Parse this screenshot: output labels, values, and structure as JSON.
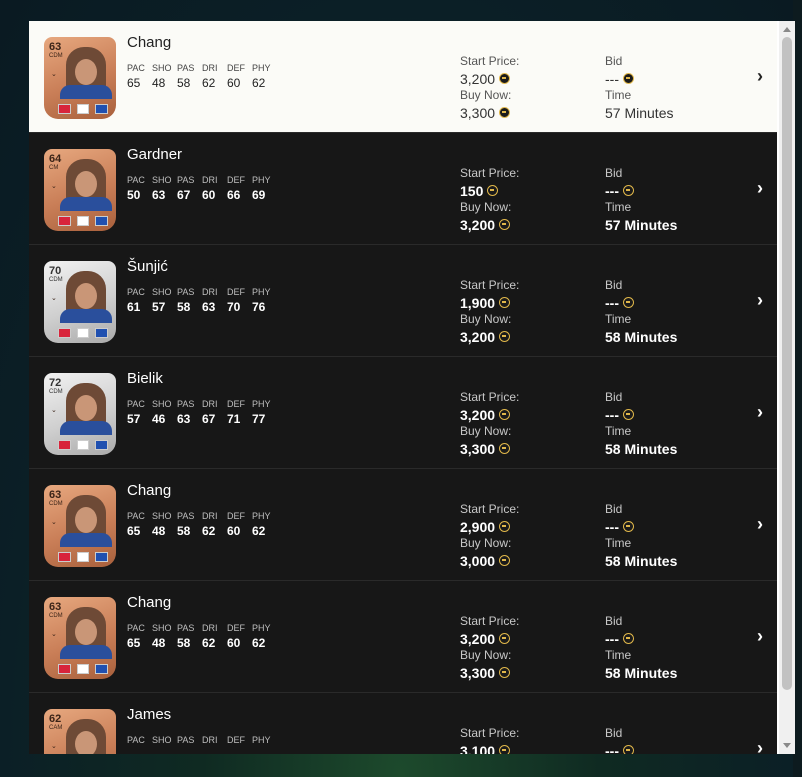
{
  "stat_labels": [
    "PAC",
    "SHO",
    "PAS",
    "DRI",
    "DEF",
    "PHY"
  ],
  "labels": {
    "start_price": "Start Price:",
    "buy_now": "Buy Now:",
    "bid": "Bid",
    "time": "Time"
  },
  "chevron_glyph": "›",
  "items": [
    {
      "name": "Chang",
      "rating": "63",
      "position": "CDM",
      "tier": "bronze",
      "stats": [
        "65",
        "48",
        "58",
        "62",
        "60",
        "62"
      ],
      "start_price": "3,200",
      "buy_now": "3,300",
      "bid": "---",
      "time": "57 Minutes",
      "selected": true
    },
    {
      "name": "Gardner",
      "rating": "64",
      "position": "CM",
      "tier": "bronze",
      "stats": [
        "50",
        "63",
        "67",
        "60",
        "66",
        "69"
      ],
      "start_price": "150",
      "buy_now": "3,200",
      "bid": "---",
      "time": "57 Minutes",
      "selected": false
    },
    {
      "name": "Šunjić",
      "rating": "70",
      "position": "CDM",
      "tier": "silver",
      "stats": [
        "61",
        "57",
        "58",
        "63",
        "70",
        "76"
      ],
      "start_price": "1,900",
      "buy_now": "3,200",
      "bid": "---",
      "time": "58 Minutes",
      "selected": false
    },
    {
      "name": "Bielik",
      "rating": "72",
      "position": "CDM",
      "tier": "silver",
      "stats": [
        "57",
        "46",
        "63",
        "67",
        "71",
        "77"
      ],
      "start_price": "3,200",
      "buy_now": "3,300",
      "bid": "---",
      "time": "58 Minutes",
      "selected": false
    },
    {
      "name": "Chang",
      "rating": "63",
      "position": "CDM",
      "tier": "bronze",
      "stats": [
        "65",
        "48",
        "58",
        "62",
        "60",
        "62"
      ],
      "start_price": "2,900",
      "buy_now": "3,000",
      "bid": "---",
      "time": "58 Minutes",
      "selected": false
    },
    {
      "name": "Chang",
      "rating": "63",
      "position": "CDM",
      "tier": "bronze",
      "stats": [
        "65",
        "48",
        "58",
        "62",
        "60",
        "62"
      ],
      "start_price": "3,200",
      "buy_now": "3,300",
      "bid": "---",
      "time": "58 Minutes",
      "selected": false
    },
    {
      "name": "James",
      "rating": "62",
      "position": "CAM",
      "tier": "bronze",
      "stats": [
        "",
        "",
        "",
        "",
        "",
        ""
      ],
      "start_price": "3,100",
      "buy_now": "",
      "bid": "---",
      "time": "",
      "selected": false
    }
  ],
  "colors": {
    "selected_row": "#fbfbf7",
    "row_bg": "#171717",
    "coin_border": "#e0b74a"
  }
}
